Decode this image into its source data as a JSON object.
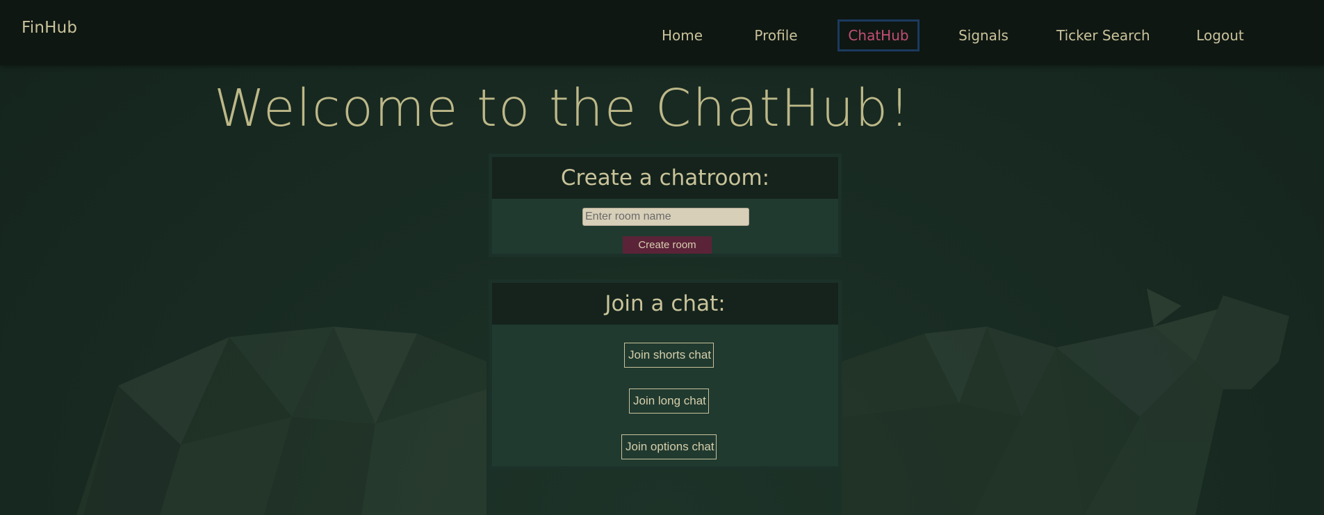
{
  "navbar": {
    "brand": "FinHub",
    "links": [
      {
        "label": "Home",
        "active": false
      },
      {
        "label": "Profile",
        "active": false
      },
      {
        "label": "ChatHub",
        "active": true
      },
      {
        "label": "Signals",
        "active": false
      },
      {
        "label": "Ticker Search",
        "active": false
      },
      {
        "label": "Logout",
        "active": false
      }
    ]
  },
  "main": {
    "title": "Welcome to the ChatHub!",
    "create_room": {
      "heading": "Create a chatroom:",
      "input_placeholder": "Enter room name",
      "input_value": "",
      "button_label": "Create room"
    },
    "join_chat": {
      "heading": "Join a chat:",
      "buttons": [
        {
          "label": "Join shorts chat"
        },
        {
          "label": "Join long chat"
        },
        {
          "label": "Join options chat"
        }
      ]
    }
  },
  "colors": {
    "background": "#172820",
    "navbar": "#0f1713",
    "text": "#c9c39a",
    "active_link": "#c24f72",
    "active_border": "#1b3a5e",
    "panel": "#213a30",
    "panel_head": "#15231c",
    "create_button": "#5b2338",
    "input_background": "#d8cfb8"
  },
  "background_art": "low-poly-bull-icon"
}
